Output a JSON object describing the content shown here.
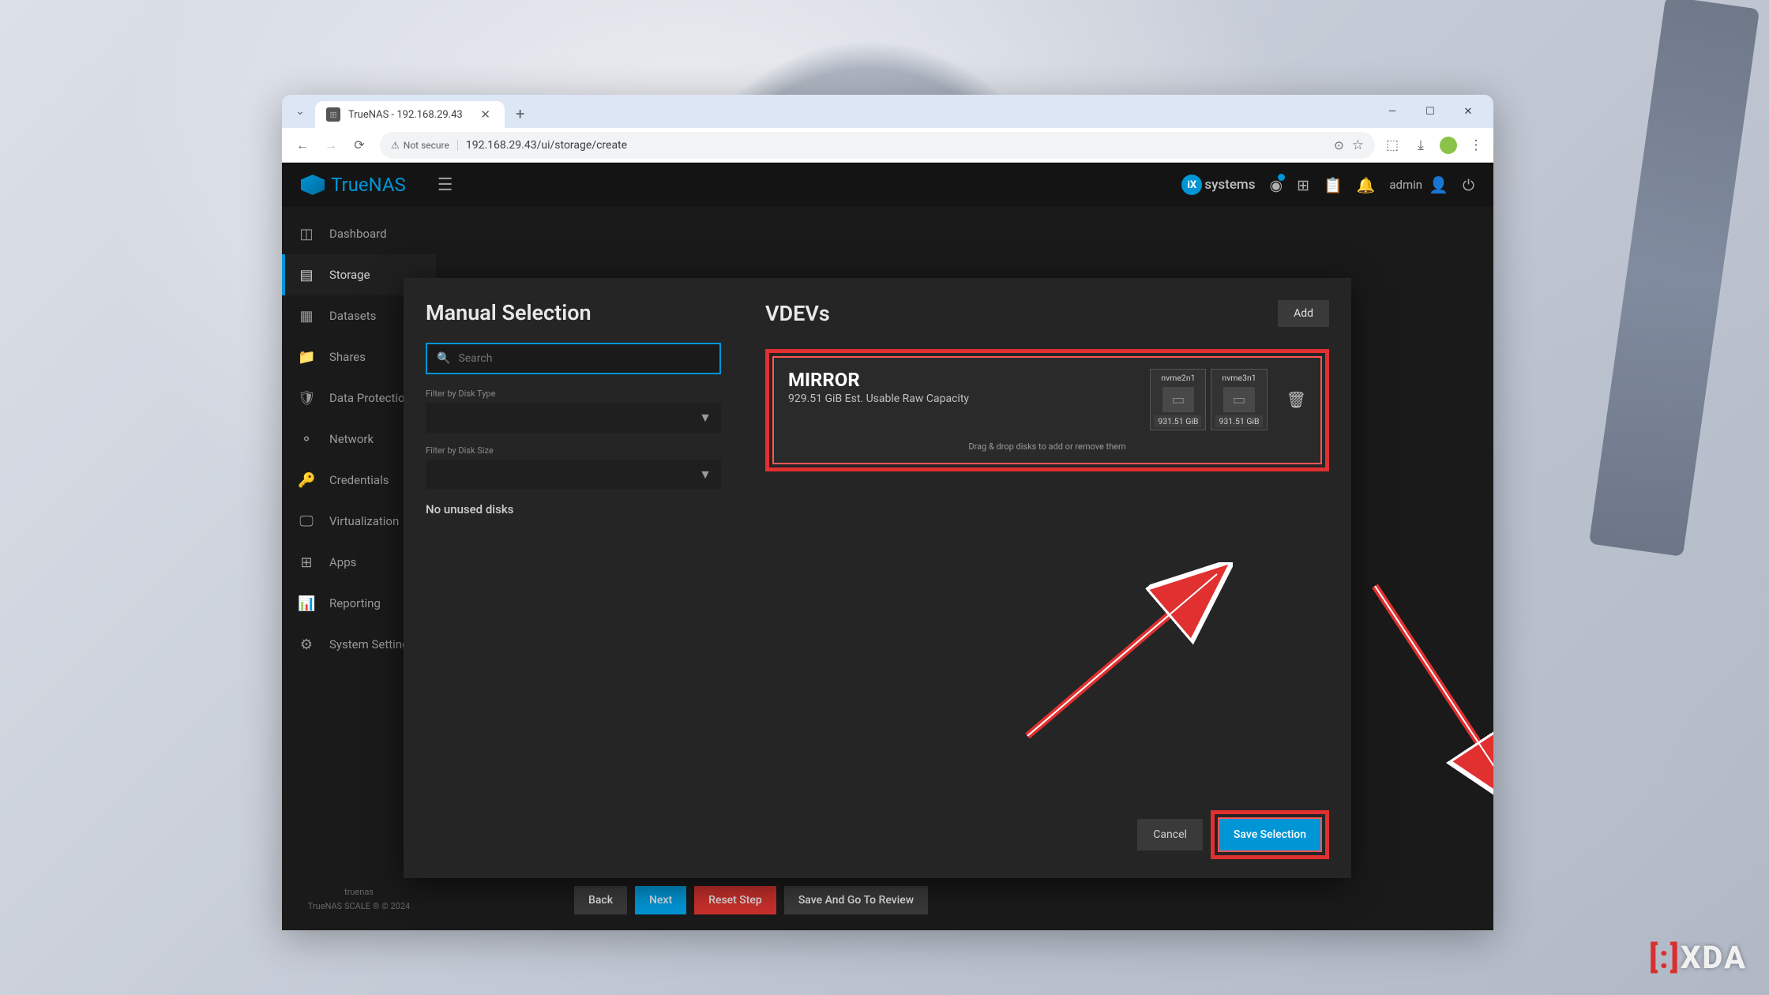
{
  "browser": {
    "tab_title": "TrueNAS - 192.168.29.43",
    "security_label": "Not secure",
    "url": "192.168.29.43/ui/storage/create"
  },
  "header": {
    "brand": "TrueNAS",
    "ix_label": "systems",
    "username": "admin"
  },
  "sidebar": {
    "items": [
      {
        "label": "Dashboard"
      },
      {
        "label": "Storage"
      },
      {
        "label": "Datasets"
      },
      {
        "label": "Shares"
      },
      {
        "label": "Data Protection"
      },
      {
        "label": "Network"
      },
      {
        "label": "Credentials"
      },
      {
        "label": "Virtualization"
      },
      {
        "label": "Apps"
      },
      {
        "label": "Reporting"
      },
      {
        "label": "System Settings"
      }
    ],
    "footer_host": "truenas",
    "footer_copy": "TrueNAS SCALE ® © 2024"
  },
  "wizard": {
    "back": "Back",
    "next": "Next",
    "reset": "Reset Step",
    "review": "Save And Go To Review"
  },
  "modal": {
    "left_title": "Manual Selection",
    "search_placeholder": "Search",
    "filter_type_label": "Filter by Disk Type",
    "filter_size_label": "Filter by Disk Size",
    "no_disks": "No unused disks",
    "right_title": "VDEVs",
    "add": "Add",
    "vdev": {
      "name": "MIRROR",
      "capacity": "929.51 GiB Est. Usable Raw Capacity",
      "disks": [
        {
          "name": "nvme2n1",
          "size": "931.51 GiB"
        },
        {
          "name": "nvme3n1",
          "size": "931.51 GiB"
        }
      ],
      "hint": "Drag & drop disks to add or remove them"
    },
    "cancel": "Cancel",
    "save": "Save Selection"
  },
  "watermark": {
    "bracket": "[:]",
    "text": "XDA"
  }
}
